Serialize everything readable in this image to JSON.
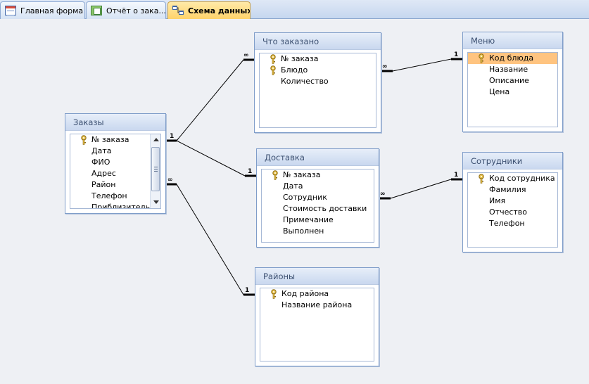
{
  "tabs": [
    {
      "label": "Главная форма",
      "icon": "form-icon",
      "active": false
    },
    {
      "label": "Отчёт о зака...",
      "icon": "report-icon",
      "active": false
    },
    {
      "label": "Схема данных",
      "icon": "relationships-icon",
      "active": true
    }
  ],
  "tables": {
    "orders": {
      "title": "Заказы",
      "fields": [
        "№ заказа",
        "Дата",
        "ФИО",
        "Адрес",
        "Район",
        "Телефон",
        "Приблизительн..."
      ],
      "key_fields": [
        0
      ]
    },
    "ordered": {
      "title": "Что заказано",
      "fields": [
        "№ заказа",
        "Блюдо",
        "Количество"
      ],
      "key_fields": [
        0,
        1
      ]
    },
    "menu": {
      "title": "Меню",
      "fields": [
        "Код блюда",
        "Название",
        "Описание",
        "Цена"
      ],
      "key_fields": [
        0
      ],
      "selected_field": 0
    },
    "delivery": {
      "title": "Доставка",
      "fields": [
        "№ заказа",
        "Дата",
        "Сотрудник",
        "Стоимость доставки",
        "Примечание",
        "Выполнен"
      ],
      "key_fields": [
        0
      ]
    },
    "employees": {
      "title": "Сотрудники",
      "fields": [
        "Код сотрудника",
        "Фамилия",
        "Имя",
        "Отчество",
        "Телефон"
      ],
      "key_fields": [
        0
      ]
    },
    "districts": {
      "title": "Районы",
      "fields": [
        "Код района",
        "Название района"
      ],
      "key_fields": [
        0
      ]
    }
  },
  "relationships": [
    {
      "from": "Заказы",
      "from_end": "1",
      "to": "Что заказано",
      "to_end": "∞"
    },
    {
      "from": "Заказы",
      "from_end": "1",
      "to": "Доставка",
      "to_end": "1"
    },
    {
      "from": "Заказы",
      "from_end": "∞",
      "to": "Районы",
      "to_end": "1"
    },
    {
      "from": "Что заказано",
      "from_end": "∞",
      "to": "Меню",
      "to_end": "1"
    },
    {
      "from": "Доставка",
      "from_end": "∞",
      "to": "Сотрудники",
      "to_end": "1"
    }
  ],
  "colors": {
    "selected_field": "#ffc480",
    "active_tab": "#ffd36a",
    "title_text": "#3b4f70",
    "key_icon": "#c9a233"
  }
}
